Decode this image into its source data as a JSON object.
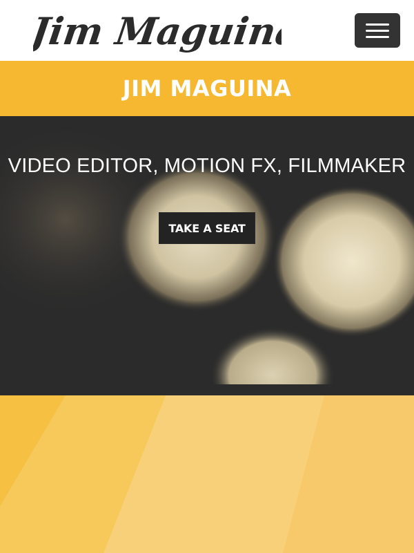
{
  "brand": {
    "logo_text": "Jim Maguina",
    "name": "JIM MAGUINA"
  },
  "nav": {
    "menu_icon": "hamburger-menu-icon"
  },
  "hero": {
    "tagline": "VIDEO EDITOR, MOTION FX, FILMMAKER",
    "cta_label": "TAKE A SEAT"
  },
  "colors": {
    "accent_yellow": "#f5b830",
    "hero_dark": "#2d2d2d",
    "button_dark": "#232323",
    "logo_ink": "#2b2b2b"
  }
}
